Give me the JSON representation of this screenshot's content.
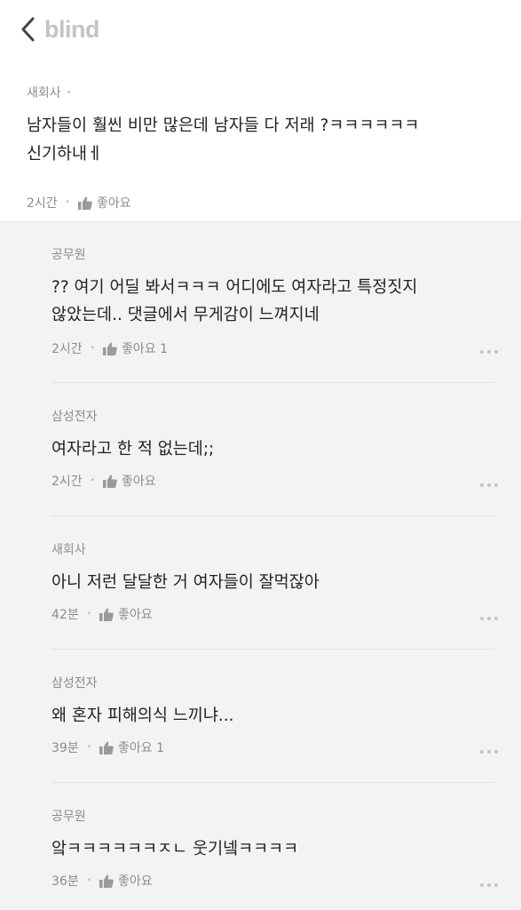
{
  "header": {
    "logo": "blind"
  },
  "post_comment": {
    "author": "새회사",
    "text_lines": [
      "남자들이 훨씬 비만 많은데 남자들 다 저래 ?ㅋㅋㅋㅋㅋㅋ",
      "신기하내ㅔ"
    ],
    "time": "2시간",
    "like_label": "좋아요"
  },
  "replies": [
    {
      "author": "공무원",
      "text_lines": [
        "?? 여기 어딜 봐서ㅋㅋㅋ 어디에도 여자라고 특정짓지",
        "않았는데.. 댓글에서 무게감이 느껴지네"
      ],
      "time": "2시간",
      "like_label": "좋아요 1"
    },
    {
      "author": "삼성전자",
      "text_lines": [
        "여자라고 한 적 없는데;;"
      ],
      "time": "2시간",
      "like_label": "좋아요"
    },
    {
      "author": "새회사",
      "text_lines": [
        "아니 저런 달달한 거 여자들이 잘먹잖아"
      ],
      "time": "42분",
      "like_label": "좋아요"
    },
    {
      "author": "삼성전자",
      "text_lines": [
        "왜 혼자 피해의식 느끼냐..."
      ],
      "time": "39분",
      "like_label": "좋아요 1"
    },
    {
      "author": "공무원",
      "text_lines": [
        "앜ㅋㅋㅋㅋㅋㅋㅈㄴ 웃기넼ㅋㅋㅋㅋ"
      ],
      "time": "36분",
      "like_label": "좋아요"
    }
  ],
  "colors": {
    "muted": "#8c8c8c",
    "logo": "#c4c4c4",
    "reply_bg": "#f3f3f3"
  },
  "icons": {
    "back": "chevron-left-icon",
    "like": "thumbs-up-icon",
    "more": "more-dots-icon"
  }
}
